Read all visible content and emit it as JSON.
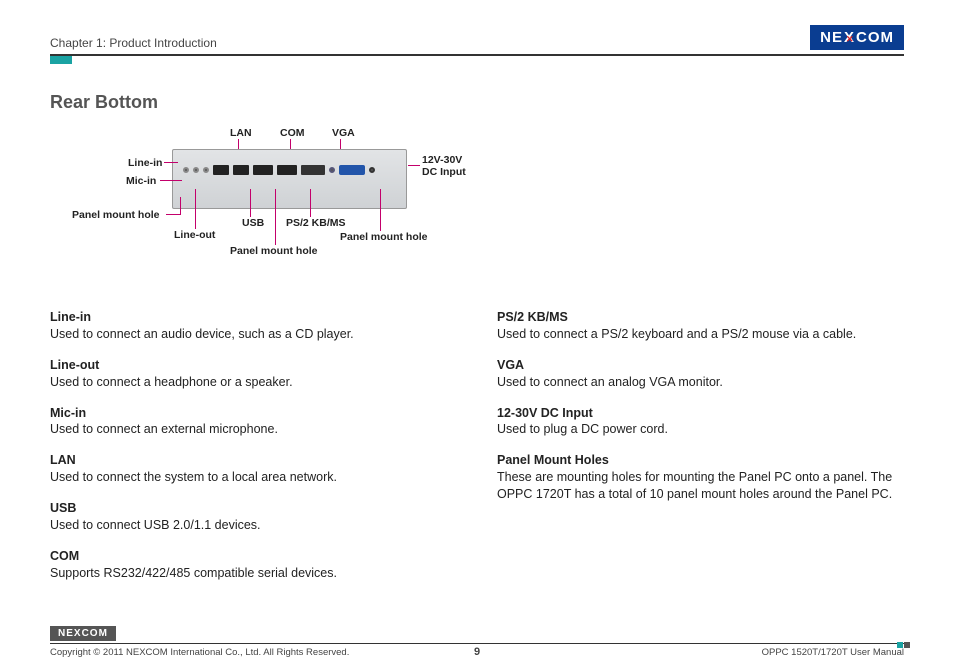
{
  "header": {
    "chapter": "Chapter 1: Product Introduction",
    "logo_pre": "NE",
    "logo_mid": "X",
    "logo_post": "COM"
  },
  "section_title": "Rear Bottom",
  "diagram": {
    "top": {
      "lan": "LAN",
      "com": "COM",
      "vga": "VGA"
    },
    "left": {
      "linein": "Line-in",
      "micin": "Mic-in",
      "pmh": "Panel mount hole"
    },
    "bottom": {
      "lineout": "Line-out",
      "usb": "USB",
      "ps2": "PS/2 KB/MS",
      "pmh1": "Panel mount hole",
      "pmh2": "Panel mount hole"
    },
    "right": {
      "dc1": "12V-30V",
      "dc2": "DC Input"
    }
  },
  "left_items": [
    {
      "title": "Line-in",
      "desc": "Used to connect an audio device, such as a CD player."
    },
    {
      "title": "Line-out",
      "desc": "Used to connect a headphone or a speaker."
    },
    {
      "title": "Mic-in",
      "desc": "Used to connect an external microphone."
    },
    {
      "title": "LAN",
      "desc": "Used to connect the system to a local area network."
    },
    {
      "title": "USB",
      "desc": "Used to connect USB 2.0/1.1 devices."
    },
    {
      "title": "COM",
      "desc": "Supports RS232/422/485 compatible serial devices."
    }
  ],
  "right_items": [
    {
      "title": "PS/2 KB/MS",
      "desc": "Used to connect a PS/2 keyboard and a PS/2 mouse via a cable."
    },
    {
      "title": "VGA",
      "desc": "Used to connect an analog VGA monitor."
    },
    {
      "title": "12-30V DC Input",
      "desc": "Used to plug a DC power cord."
    },
    {
      "title": "Panel Mount Holes",
      "desc": "These are mounting holes for mounting the Panel PC onto a panel. The OPPC 1720T has a total of 10 panel mount holes around the Panel PC."
    }
  ],
  "footer": {
    "logo_pre": "NE",
    "logo_mid": "X",
    "logo_post": "COM",
    "copyright": "Copyright © 2011 NEXCOM International Co., Ltd. All Rights Reserved.",
    "page": "9",
    "manual": "OPPC 1520T/1720T User Manual"
  }
}
